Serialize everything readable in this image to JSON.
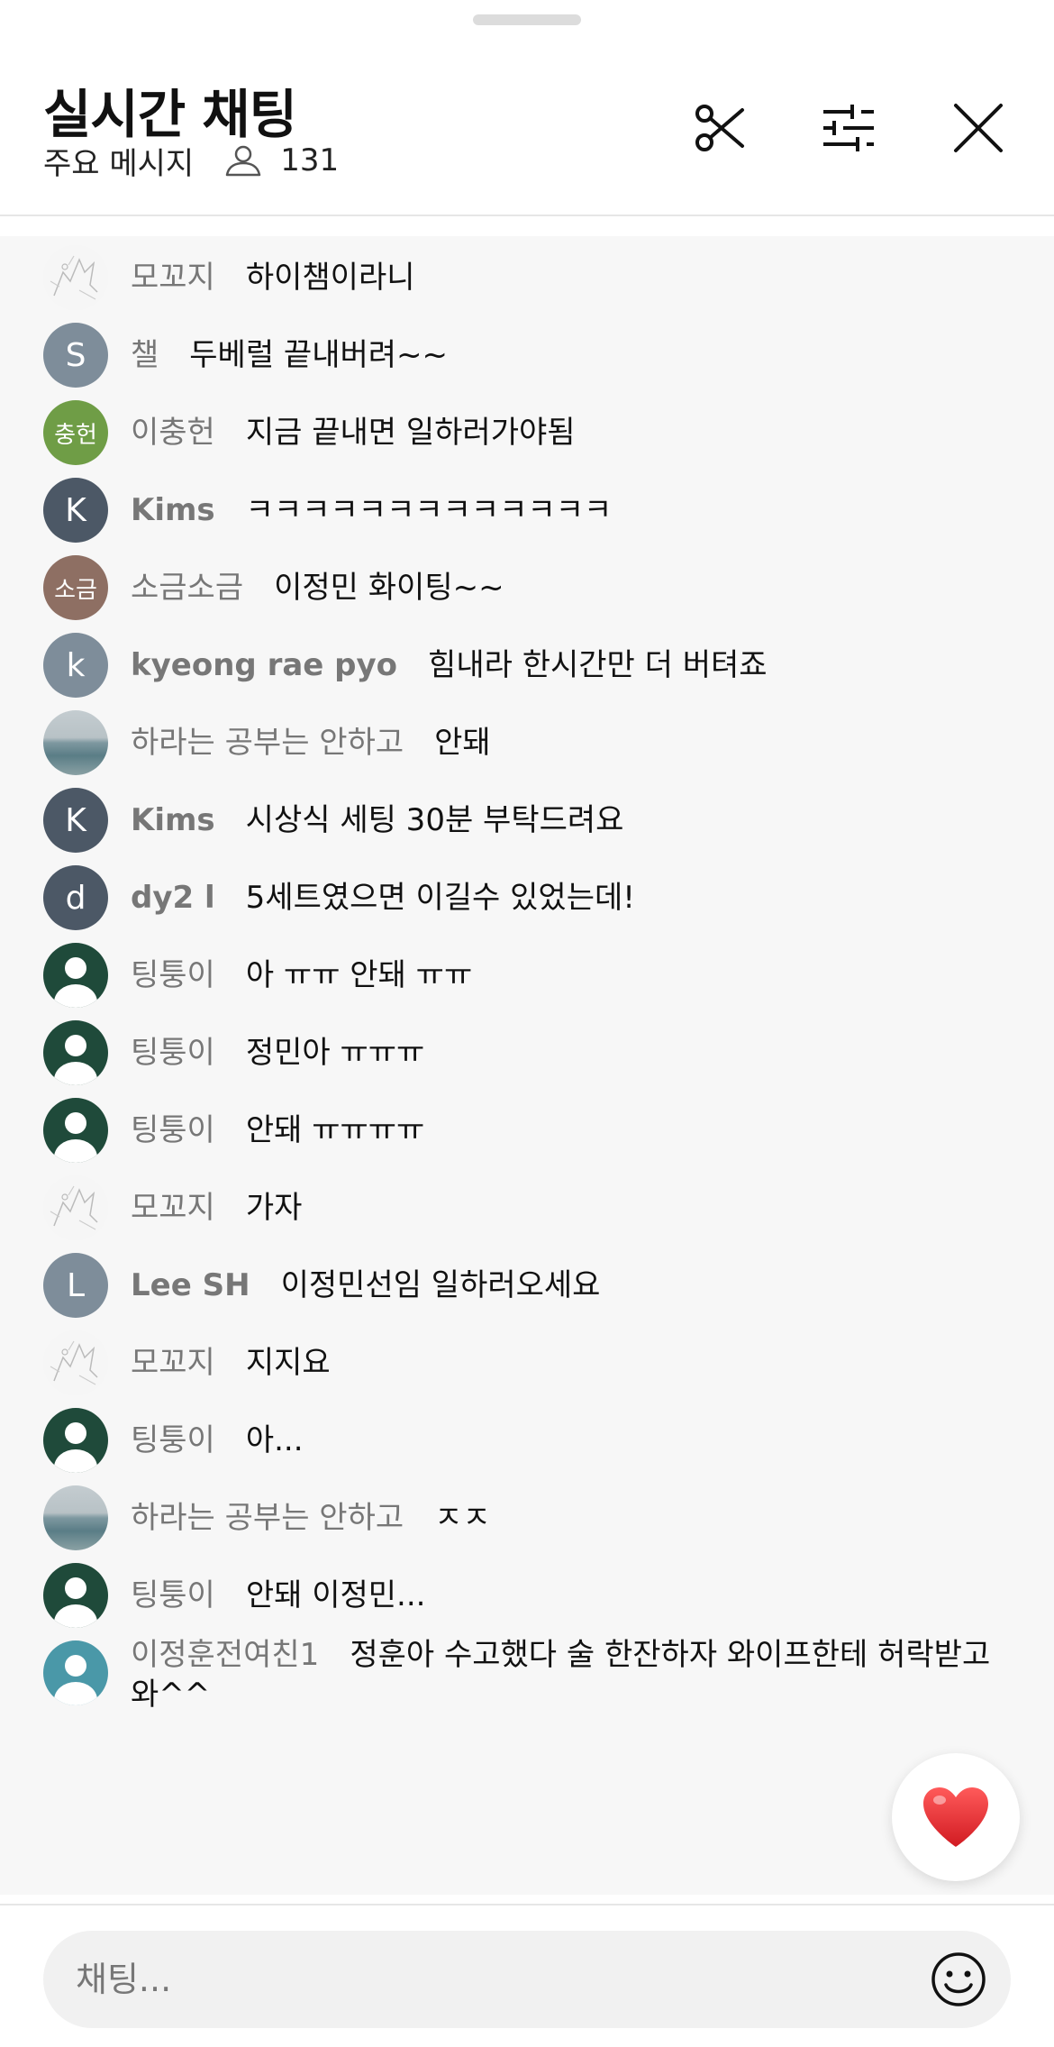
{
  "header": {
    "title": "실시간 채팅",
    "mode_label": "주요 메시지",
    "viewer_count": "131",
    "icons": [
      "person-icon",
      "scissors-icon",
      "sliders-icon",
      "close-icon"
    ]
  },
  "messages": [
    {
      "name": "모꼬지",
      "text": "하이챔이라니",
      "avatar": {
        "type": "sketch"
      }
    },
    {
      "name": "챌",
      "text": "두베럴 끝내버려~~",
      "avatar": {
        "type": "letter",
        "label": "S",
        "color": "#7e8d9a"
      }
    },
    {
      "name": "이충헌",
      "text": "지금 끝내면 일하러가야됨",
      "avatar": {
        "type": "letter",
        "label": "충헌",
        "color": "#6f9d46"
      }
    },
    {
      "name": "Kims",
      "text": "ㅋㅋㅋㅋㅋㅋㅋㅋㅋㅋㅋㅋㅋ",
      "avatar": {
        "type": "letter",
        "label": "K",
        "color": "#4c5866"
      }
    },
    {
      "name": "소금소금",
      "text": "이정민 화이팅~~",
      "avatar": {
        "type": "letter",
        "label": "소금",
        "color": "#8e6f63"
      }
    },
    {
      "name": "kyeong rae pyo",
      "text": "힘내라 한시간만 더 버텨죠",
      "avatar": {
        "type": "letter",
        "label": "k",
        "color": "#7e8d9a"
      }
    },
    {
      "name": "하라는 공부는 안하고",
      "text": "안돼",
      "avatar": {
        "type": "sea"
      }
    },
    {
      "name": "Kims",
      "text": "시상식 세팅 30분 부탁드려요",
      "avatar": {
        "type": "letter",
        "label": "K",
        "color": "#4c5866"
      }
    },
    {
      "name": "dy2 l",
      "text": "5세트였으면 이길수 있었는데!",
      "avatar": {
        "type": "letter",
        "label": "d",
        "color": "#4c5866"
      }
    },
    {
      "name": "팅퉁이",
      "text": "아 ㅠㅠ 안돼 ㅠㅠ",
      "avatar": {
        "type": "person",
        "color": "#1f4a3a"
      }
    },
    {
      "name": "팅퉁이",
      "text": "정민아 ㅠㅠㅠ",
      "avatar": {
        "type": "person",
        "color": "#1f4a3a"
      }
    },
    {
      "name": "팅퉁이",
      "text": "안돼 ㅠㅠㅠㅠ",
      "avatar": {
        "type": "person",
        "color": "#1f4a3a"
      }
    },
    {
      "name": "모꼬지",
      "text": "가자",
      "avatar": {
        "type": "sketch"
      }
    },
    {
      "name": "Lee SH",
      "text": "이정민선임 일하러오세요",
      "avatar": {
        "type": "letter",
        "label": "L",
        "color": "#7e8d9a"
      }
    },
    {
      "name": "모꼬지",
      "text": "지지요",
      "avatar": {
        "type": "sketch"
      }
    },
    {
      "name": "팅퉁이",
      "text": "아...",
      "avatar": {
        "type": "person",
        "color": "#1f4a3a"
      }
    },
    {
      "name": "하라는 공부는 안하고",
      "text": "ㅈㅈ",
      "avatar": {
        "type": "sea"
      }
    },
    {
      "name": "팅퉁이",
      "text": "안돼 이정민...",
      "avatar": {
        "type": "person",
        "color": "#1f4a3a"
      }
    },
    {
      "name": "이정훈전여친1",
      "text": "정훈아 수고했다 술 한잔하자 와이프한테 허락받고 와^^",
      "avatar": {
        "type": "person",
        "color": "#4a98a8"
      }
    }
  ],
  "reaction": {
    "icon": "heart-icon",
    "color": "#e0262b"
  },
  "input": {
    "placeholder": "채팅...",
    "value": "",
    "emoji_icon": "smiley-icon"
  }
}
